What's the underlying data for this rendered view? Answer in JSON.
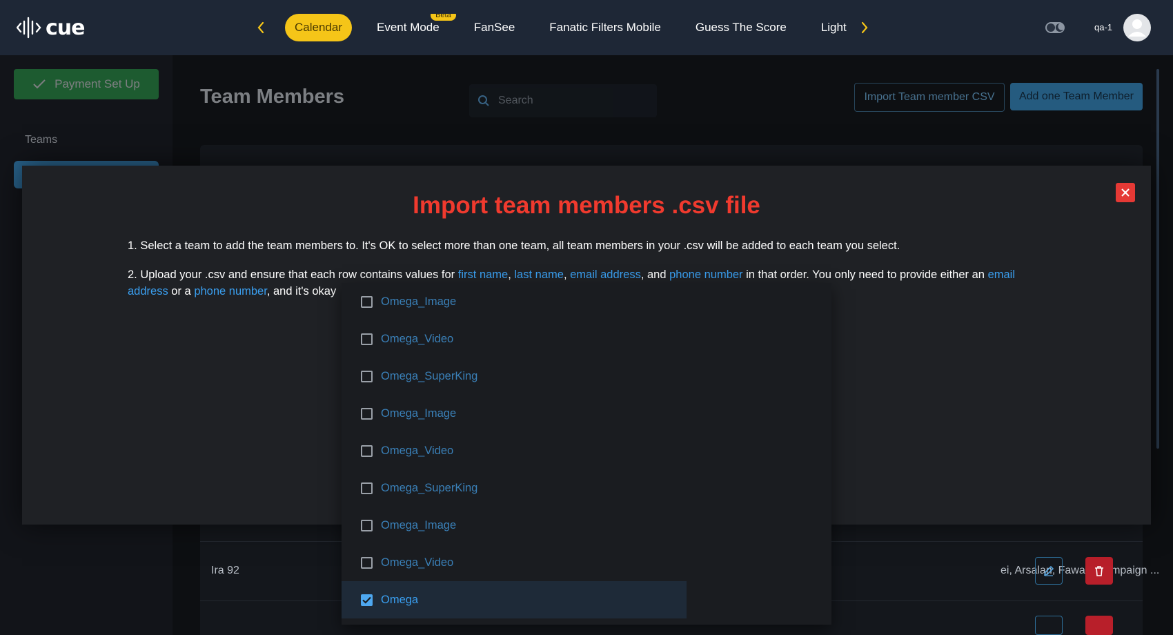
{
  "app": {
    "logo_text": "cue"
  },
  "nav": {
    "items": [
      {
        "label": "Calendar",
        "active": true
      },
      {
        "label": "Event Mode",
        "badge": "Beta"
      },
      {
        "label": "FanSee"
      },
      {
        "label": "Fanatic Filters Mobile"
      },
      {
        "label": "Guess The Score"
      },
      {
        "label": "Light"
      }
    ]
  },
  "user": {
    "name": "qa-1"
  },
  "sidebar": {
    "payment_label": "Payment Set Up",
    "teams_label": "Teams"
  },
  "main": {
    "title": "Team Members",
    "search_placeholder": "Search",
    "import_button": "Import Team member CSV",
    "add_button": "Add one Team Member",
    "rows": [
      {
        "name": "Ira 92",
        "teams": "ei, Arsalan, Fawaz, Campaign ..."
      }
    ]
  },
  "modal": {
    "title": "Import team members .csv file",
    "step1": "1. Select a team to add the team members to. It's OK to select more than one team, all team members in your .csv will be added to each team you select.",
    "step2": {
      "p1": "2. Upload your .csv and ensure that each row contains values for ",
      "first_name": "first name",
      "sep1": ", ",
      "last_name": "last name",
      "sep2": ", ",
      "email": "email address",
      "sep3": ", and ",
      "phone": "phone number",
      "p2": " in that order. You only need to provide either an ",
      "email2": "email address",
      "p3": " or a ",
      "phone2": "phone number",
      "p4": ", and it's okay"
    }
  },
  "dropdown": {
    "options": [
      {
        "label": "Omega_Image",
        "checked": false
      },
      {
        "label": "Omega_Video",
        "checked": false
      },
      {
        "label": "Omega_SuperKing",
        "checked": false
      },
      {
        "label": "Omega_Image",
        "checked": false
      },
      {
        "label": "Omega_Video",
        "checked": false
      },
      {
        "label": "Omega_SuperKing",
        "checked": false
      },
      {
        "label": "Omega_Image",
        "checked": false
      },
      {
        "label": "Omega_Video",
        "checked": false
      },
      {
        "label": "Omega",
        "checked": true
      }
    ]
  },
  "colors": {
    "accent_yellow": "#f5c518",
    "accent_blue": "#3a9ff0",
    "danger_red": "#e53935",
    "title_red": "#f03a2e",
    "topbar_bg": "#1e2736"
  }
}
